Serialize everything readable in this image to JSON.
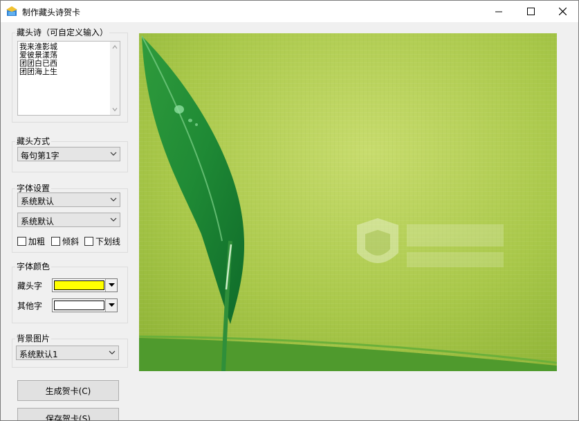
{
  "window": {
    "title": "制作藏头诗贺卡"
  },
  "poem": {
    "group_label": "藏头诗（可自定义输入）",
    "lines": [
      "我来淮影城",
      "爱彼景漾荡",
      "团团白已西",
      "团团海上生"
    ]
  },
  "mode": {
    "group_label": "藏头方式",
    "selected": "每句第1字"
  },
  "font": {
    "group_label": "字体设置",
    "family_selected": "系统默认",
    "size_selected": "系统默认",
    "bold_label": "加粗",
    "italic_label": "倾斜",
    "underline_label": "下划线"
  },
  "color": {
    "group_label": "字体颜色",
    "head_label": "藏头字",
    "head_color": "#ffff00",
    "other_label": "其他字",
    "other_color": "#ffffff"
  },
  "background": {
    "group_label": "背景图片",
    "selected": "系统默认1"
  },
  "buttons": {
    "generate": "生成贺卡(C)",
    "save": "保存贺卡(S)"
  }
}
